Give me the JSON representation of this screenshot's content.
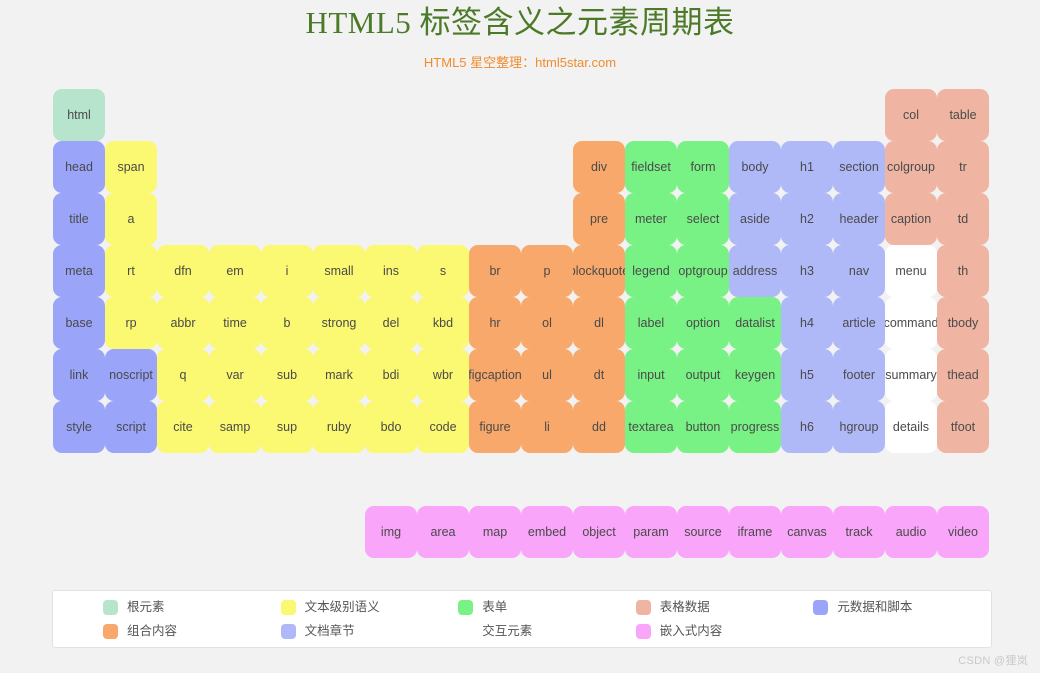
{
  "header": {
    "title": "HTML5 标签含义之元素周期表",
    "subtitle": "HTML5 星空整理：html5star.com",
    "title_color": "#4c7a28",
    "subtitle_color": "#f08c2e"
  },
  "watermark": "CSDN @狸岚",
  "palette": {
    "root": "#b7e4cd",
    "text_level": "#fbf871",
    "form": "#79f285",
    "grouping": "#f8a86a",
    "sections": "#b0b9f7",
    "metadata": "#9aa4f9",
    "tabular": "#f0b5a2",
    "embedded": "#f9a5f9",
    "interactive": "#ffffff",
    "page_background": "#f2f2f2"
  },
  "periodic_table": {
    "columns": 18,
    "rows": 7,
    "cells": [
      [
        {
          "label": "html",
          "category": "root"
        },
        null,
        null,
        null,
        null,
        null,
        null,
        null,
        null,
        null,
        null,
        null,
        null,
        null,
        null,
        null,
        {
          "label": "col",
          "category": "tabular"
        },
        {
          "label": "table",
          "category": "tabular"
        }
      ],
      [
        {
          "label": "head",
          "category": "metadata"
        },
        {
          "label": "span",
          "category": "text_level"
        },
        null,
        null,
        null,
        null,
        null,
        null,
        null,
        null,
        {
          "label": "div",
          "category": "grouping"
        },
        {
          "label": "fieldset",
          "category": "form"
        },
        {
          "label": "form",
          "category": "form"
        },
        {
          "label": "body",
          "category": "sections"
        },
        {
          "label": "h1",
          "category": "sections"
        },
        {
          "label": "section",
          "category": "sections"
        },
        {
          "label": "colgroup",
          "category": "tabular"
        },
        {
          "label": "tr",
          "category": "tabular"
        }
      ],
      [
        {
          "label": "title",
          "category": "metadata"
        },
        {
          "label": "a",
          "category": "text_level"
        },
        null,
        null,
        null,
        null,
        null,
        null,
        null,
        null,
        {
          "label": "pre",
          "category": "grouping"
        },
        {
          "label": "meter",
          "category": "form"
        },
        {
          "label": "select",
          "category": "form"
        },
        {
          "label": "aside",
          "category": "sections"
        },
        {
          "label": "h2",
          "category": "sections"
        },
        {
          "label": "header",
          "category": "sections"
        },
        {
          "label": "caption",
          "category": "tabular"
        },
        {
          "label": "td",
          "category": "tabular"
        }
      ],
      [
        {
          "label": "meta",
          "category": "metadata"
        },
        {
          "label": "rt",
          "category": "text_level"
        },
        {
          "label": "dfn",
          "category": "text_level"
        },
        {
          "label": "em",
          "category": "text_level"
        },
        {
          "label": "i",
          "category": "text_level"
        },
        {
          "label": "small",
          "category": "text_level"
        },
        {
          "label": "ins",
          "category": "text_level"
        },
        {
          "label": "s",
          "category": "text_level"
        },
        {
          "label": "br",
          "category": "grouping"
        },
        {
          "label": "p",
          "category": "grouping"
        },
        {
          "label": "blockquote",
          "category": "grouping"
        },
        {
          "label": "legend",
          "category": "form"
        },
        {
          "label": "optgroup",
          "category": "form"
        },
        {
          "label": "address",
          "category": "sections"
        },
        {
          "label": "h3",
          "category": "sections"
        },
        {
          "label": "nav",
          "category": "sections"
        },
        {
          "label": "menu",
          "category": "interactive"
        },
        {
          "label": "th",
          "category": "tabular"
        }
      ],
      [
        {
          "label": "base",
          "category": "metadata"
        },
        {
          "label": "rp",
          "category": "text_level"
        },
        {
          "label": "abbr",
          "category": "text_level"
        },
        {
          "label": "time",
          "category": "text_level"
        },
        {
          "label": "b",
          "category": "text_level"
        },
        {
          "label": "strong",
          "category": "text_level"
        },
        {
          "label": "del",
          "category": "text_level"
        },
        {
          "label": "kbd",
          "category": "text_level"
        },
        {
          "label": "hr",
          "category": "grouping"
        },
        {
          "label": "ol",
          "category": "grouping"
        },
        {
          "label": "dl",
          "category": "grouping"
        },
        {
          "label": "label",
          "category": "form"
        },
        {
          "label": "option",
          "category": "form"
        },
        {
          "label": "datalist",
          "category": "form"
        },
        {
          "label": "h4",
          "category": "sections"
        },
        {
          "label": "article",
          "category": "sections"
        },
        {
          "label": "command",
          "category": "interactive"
        },
        {
          "label": "tbody",
          "category": "tabular"
        }
      ],
      [
        {
          "label": "link",
          "category": "metadata"
        },
        {
          "label": "noscript",
          "category": "metadata"
        },
        {
          "label": "q",
          "category": "text_level"
        },
        {
          "label": "var",
          "category": "text_level"
        },
        {
          "label": "sub",
          "category": "text_level"
        },
        {
          "label": "mark",
          "category": "text_level"
        },
        {
          "label": "bdi",
          "category": "text_level"
        },
        {
          "label": "wbr",
          "category": "text_level"
        },
        {
          "label": "figcaption",
          "category": "grouping"
        },
        {
          "label": "ul",
          "category": "grouping"
        },
        {
          "label": "dt",
          "category": "grouping"
        },
        {
          "label": "input",
          "category": "form"
        },
        {
          "label": "output",
          "category": "form"
        },
        {
          "label": "keygen",
          "category": "form"
        },
        {
          "label": "h5",
          "category": "sections"
        },
        {
          "label": "footer",
          "category": "sections"
        },
        {
          "label": "summary",
          "category": "interactive"
        },
        {
          "label": "thead",
          "category": "tabular"
        }
      ],
      [
        {
          "label": "style",
          "category": "metadata"
        },
        {
          "label": "script",
          "category": "metadata"
        },
        {
          "label": "cite",
          "category": "text_level"
        },
        {
          "label": "samp",
          "category": "text_level"
        },
        {
          "label": "sup",
          "category": "text_level"
        },
        {
          "label": "ruby",
          "category": "text_level"
        },
        {
          "label": "bdo",
          "category": "text_level"
        },
        {
          "label": "code",
          "category": "text_level"
        },
        {
          "label": "figure",
          "category": "grouping"
        },
        {
          "label": "li",
          "category": "grouping"
        },
        {
          "label": "dd",
          "category": "grouping"
        },
        {
          "label": "textarea",
          "category": "form"
        },
        {
          "label": "button",
          "category": "form"
        },
        {
          "label": "progress",
          "category": "form"
        },
        {
          "label": "h6",
          "category": "sections"
        },
        {
          "label": "hgroup",
          "category": "sections"
        },
        {
          "label": "details",
          "category": "interactive"
        },
        {
          "label": "tfoot",
          "category": "tabular"
        }
      ]
    ]
  },
  "embedded_row": {
    "category": "embedded",
    "cells": [
      {
        "label": "img"
      },
      {
        "label": "area"
      },
      {
        "label": "map"
      },
      {
        "label": "embed"
      },
      {
        "label": "object"
      },
      {
        "label": "param"
      },
      {
        "label": "source"
      },
      {
        "label": "iframe"
      },
      {
        "label": "canvas"
      },
      {
        "label": "track"
      },
      {
        "label": "audio"
      },
      {
        "label": "video"
      }
    ]
  },
  "legend": {
    "items": [
      {
        "label": "根元素",
        "color": "#b7e4cd",
        "category": "root"
      },
      {
        "label": "组合内容",
        "color": "#f8a86a",
        "category": "grouping"
      },
      {
        "label": "文本级别语义",
        "color": "#fbf871",
        "category": "text_level"
      },
      {
        "label": "文档章节",
        "color": "#b0b9f7",
        "category": "sections"
      },
      {
        "label": "表单",
        "color": "#79f285",
        "category": "form"
      },
      {
        "label": "交互元素",
        "color": "#ffffff",
        "category": "interactive"
      },
      {
        "label": "表格数据",
        "color": "#f0b5a2",
        "category": "tabular"
      },
      {
        "label": "嵌入式内容",
        "color": "#f9a5f9",
        "category": "embedded"
      },
      {
        "label": "元数据和脚本",
        "color": "#9aa4f9",
        "category": "metadata"
      }
    ]
  }
}
